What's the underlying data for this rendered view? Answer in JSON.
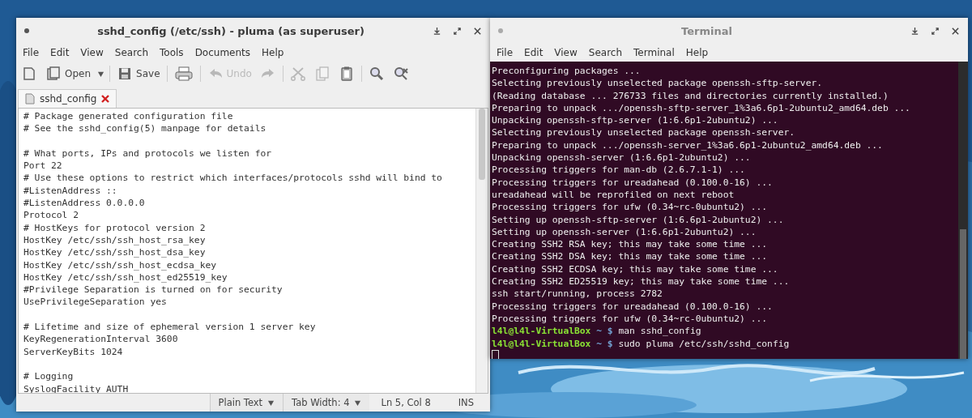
{
  "editor": {
    "title": "sshd_config (/etc/ssh) - pluma (as superuser)",
    "menu": [
      "File",
      "Edit",
      "View",
      "Search",
      "Tools",
      "Documents",
      "Help"
    ],
    "toolbar": [
      {
        "kind": "new",
        "disabled": false
      },
      {
        "kind": "open",
        "label": "Open",
        "disabled": false
      },
      {
        "kind": "dropdown"
      },
      {
        "kind": "separator"
      },
      {
        "kind": "save",
        "label": "Save",
        "disabled": false
      },
      {
        "kind": "separator"
      },
      {
        "kind": "print",
        "disabled": false
      },
      {
        "kind": "separator"
      },
      {
        "kind": "undo",
        "label": "Undo",
        "disabled": true
      },
      {
        "kind": "redo",
        "disabled": true
      },
      {
        "kind": "separator"
      },
      {
        "kind": "cut",
        "disabled": true
      },
      {
        "kind": "copy",
        "disabled": true
      },
      {
        "kind": "paste",
        "disabled": false
      },
      {
        "kind": "separator"
      },
      {
        "kind": "find",
        "disabled": false
      },
      {
        "kind": "replace",
        "disabled": false
      }
    ],
    "tabs": [
      {
        "label": "sshd_config",
        "selected": true
      }
    ],
    "lines": [
      {
        "kind": "text",
        "text": "# Package generated configuration file"
      },
      {
        "kind": "text",
        "text": "# See the sshd_config(5) manpage for details"
      },
      {
        "kind": "blank"
      },
      {
        "kind": "text",
        "text": "# What ports, IPs and protocols we listen for"
      },
      {
        "kind": "text",
        "text": "Port 22"
      },
      {
        "kind": "text",
        "text": "# Use these options to restrict which interfaces/protocols sshd will bind to"
      },
      {
        "kind": "text",
        "text": "#ListenAddress ::"
      },
      {
        "kind": "text",
        "text": "#ListenAddress 0.0.0.0"
      },
      {
        "kind": "text",
        "text": "Protocol 2"
      },
      {
        "kind": "text",
        "text": "# HostKeys for protocol version 2"
      },
      {
        "kind": "text",
        "text": "HostKey /etc/ssh/ssh_host_rsa_key"
      },
      {
        "kind": "text",
        "text": "HostKey /etc/ssh/ssh_host_dsa_key"
      },
      {
        "kind": "text",
        "text": "HostKey /etc/ssh/ssh_host_ecdsa_key"
      },
      {
        "kind": "text",
        "text": "HostKey /etc/ssh/ssh_host_ed25519_key"
      },
      {
        "kind": "text",
        "text": "#Privilege Separation is turned on for security"
      },
      {
        "kind": "text",
        "text": "UsePrivilegeSeparation yes"
      },
      {
        "kind": "blank"
      },
      {
        "kind": "text",
        "text": "# Lifetime and size of ephemeral version 1 server key"
      },
      {
        "kind": "text",
        "text": "KeyRegenerationInterval 3600"
      },
      {
        "kind": "text",
        "text": "ServerKeyBits 1024"
      },
      {
        "kind": "blank"
      },
      {
        "kind": "text",
        "text": "# Logging"
      },
      {
        "kind": "text",
        "text": "SyslogFacility AUTH"
      }
    ],
    "status_bar": {
      "language": "Plain Text",
      "tab_width": "Tab Width:  4",
      "position": "Ln 5, Col 8",
      "mode": "INS"
    }
  },
  "terminal": {
    "title": "Terminal",
    "menu": [
      "File",
      "Edit",
      "View",
      "Search",
      "Terminal",
      "Help"
    ],
    "lines": [
      {
        "kind": "output",
        "text": "Preconfiguring packages ..."
      },
      {
        "kind": "output",
        "text": "Selecting previously unselected package openssh-sftp-server."
      },
      {
        "kind": "output",
        "text": "(Reading database ... 276733 files and directories currently installed.)"
      },
      {
        "kind": "output",
        "text": "Preparing to unpack .../openssh-sftp-server_1%3a6.6p1-2ubuntu2_amd64.deb ..."
      },
      {
        "kind": "output",
        "text": "Unpacking openssh-sftp-server (1:6.6p1-2ubuntu2) ..."
      },
      {
        "kind": "output",
        "text": "Selecting previously unselected package openssh-server."
      },
      {
        "kind": "output",
        "text": "Preparing to unpack .../openssh-server_1%3a6.6p1-2ubuntu2_amd64.deb ..."
      },
      {
        "kind": "output",
        "text": "Unpacking openssh-server (1:6.6p1-2ubuntu2) ..."
      },
      {
        "kind": "output",
        "text": "Processing triggers for man-db (2.6.7.1-1) ..."
      },
      {
        "kind": "output",
        "text": "Processing triggers for ureadahead (0.100.0-16) ..."
      },
      {
        "kind": "output",
        "text": "ureadahead will be reprofiled on next reboot"
      },
      {
        "kind": "output",
        "text": "Processing triggers for ufw (0.34~rc-0ubuntu2) ..."
      },
      {
        "kind": "output",
        "text": "Setting up openssh-sftp-server (1:6.6p1-2ubuntu2) ..."
      },
      {
        "kind": "output",
        "text": "Setting up openssh-server (1:6.6p1-2ubuntu2) ..."
      },
      {
        "kind": "output",
        "text": "Creating SSH2 RSA key; this may take some time ..."
      },
      {
        "kind": "output",
        "text": "Creating SSH2 DSA key; this may take some time ..."
      },
      {
        "kind": "output",
        "text": "Creating SSH2 ECDSA key; this may take some time ..."
      },
      {
        "kind": "output",
        "text": "Creating SSH2 ED25519 key; this may take some time ..."
      },
      {
        "kind": "output",
        "text": "ssh start/running, process 2782"
      },
      {
        "kind": "output",
        "text": "Processing triggers for ureadahead (0.100.0-16) ..."
      },
      {
        "kind": "output",
        "text": "Processing triggers for ufw (0.34~rc-0ubuntu2) ..."
      },
      {
        "kind": "prompt",
        "user": "l4l@l4l-VirtualBox",
        "path": "~ $",
        "command": "man sshd_config"
      },
      {
        "kind": "prompt",
        "user": "l4l@l4l-VirtualBox",
        "path": "~ $",
        "command": "sudo pluma /etc/ssh/sshd_config"
      },
      {
        "kind": "cursor"
      }
    ]
  }
}
